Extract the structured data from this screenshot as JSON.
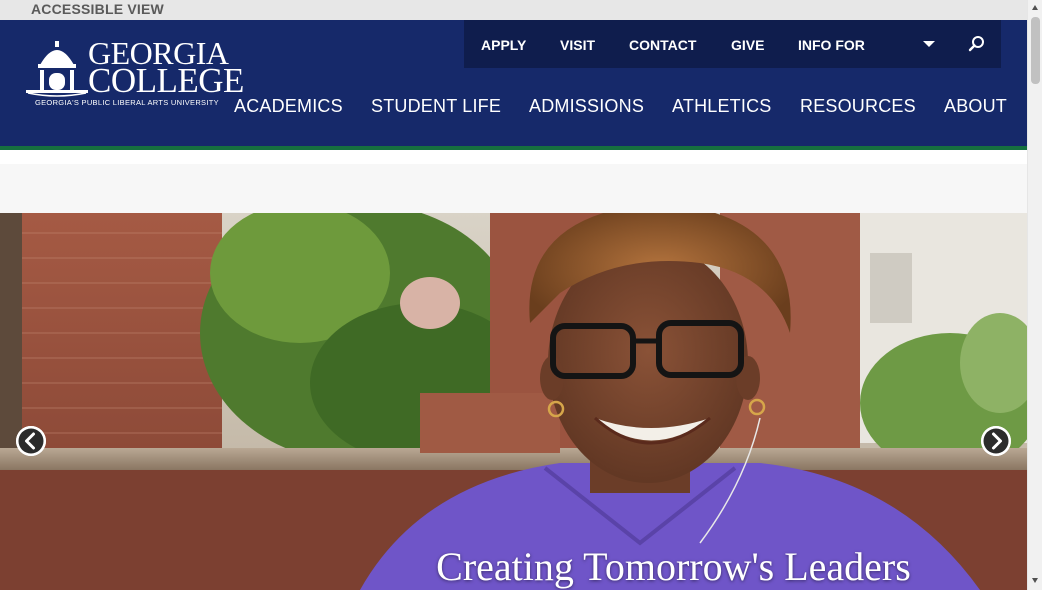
{
  "accessible_view": "ACCESSIBLE VIEW",
  "logo": {
    "line1": "GEORGIA",
    "line2": "COLLEGE",
    "tagline": "GEORGIA'S PUBLIC LIBERAL ARTS UNIVERSITY"
  },
  "utility_nav": {
    "items": [
      "APPLY",
      "VISIT",
      "CONTACT",
      "GIVE",
      "INFO FOR"
    ],
    "info_for_icon": "caret-down-icon",
    "search_icon": "search-icon"
  },
  "main_nav": {
    "items": [
      "ACADEMICS",
      "STUDENT LIFE",
      "ADMISSIONS",
      "ATHLETICS",
      "RESOURCES",
      "ABOUT"
    ]
  },
  "hero": {
    "caption": "Creating Tomorrow's Leaders",
    "prev_icon": "chevron-left-icon",
    "next_icon": "chevron-right-icon"
  },
  "colors": {
    "header_bg": "#16296a",
    "utility_bg": "#0f1d4d",
    "accent_stripe": "#16703f",
    "access_bar_bg": "#e7e7e7"
  }
}
